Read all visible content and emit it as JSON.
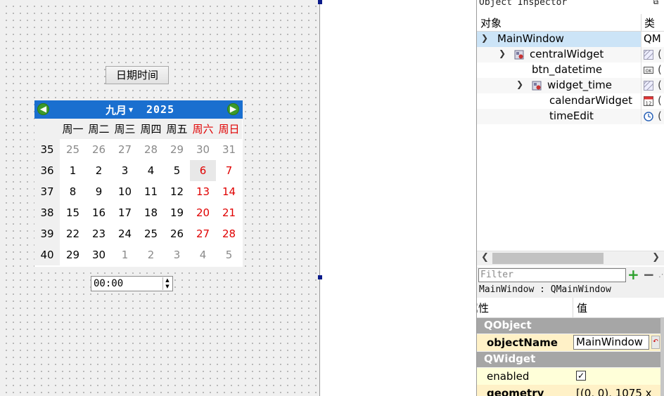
{
  "form": {
    "button_label": "日期时间",
    "calendar": {
      "month": "九月",
      "year": "2025",
      "weekday_headers": [
        "周一",
        "周二",
        "周三",
        "周四",
        "周五",
        "周六",
        "周日"
      ],
      "weeks": [
        {
          "num": "35",
          "days": [
            "25",
            "26",
            "27",
            "28",
            "29",
            "30",
            "31"
          ]
        },
        {
          "num": "36",
          "days": [
            "1",
            "2",
            "3",
            "4",
            "5",
            "6",
            "7"
          ]
        },
        {
          "num": "37",
          "days": [
            "8",
            "9",
            "10",
            "11",
            "12",
            "13",
            "14"
          ]
        },
        {
          "num": "38",
          "days": [
            "15",
            "16",
            "17",
            "18",
            "19",
            "20",
            "21"
          ]
        },
        {
          "num": "39",
          "days": [
            "22",
            "23",
            "24",
            "25",
            "26",
            "27",
            "28"
          ]
        },
        {
          "num": "40",
          "days": [
            "29",
            "30",
            "1",
            "2",
            "3",
            "4",
            "5"
          ]
        }
      ],
      "selected_day": "6"
    },
    "time_value": "00:00"
  },
  "inspector": {
    "title": "Object Inspector",
    "col_object": "对象",
    "col_class": "类",
    "tree": [
      {
        "name": "MainWindow",
        "class_text": "QM"
      },
      {
        "name": "centralWidget"
      },
      {
        "name": "btn_datetime"
      },
      {
        "name": "widget_time"
      },
      {
        "name": "calendarWidget"
      },
      {
        "name": "timeEdit"
      }
    ],
    "class_initial": "("
  },
  "property_editor": {
    "filter_placeholder": "Filter",
    "object_class": "MainWindow : QMainWindow",
    "col_property": "属性",
    "col_value": "值",
    "groups": [
      "QObject",
      "QWidget"
    ],
    "props": {
      "objectName": {
        "name": "objectName",
        "value": "MainWindow"
      },
      "enabled": {
        "name": "enabled"
      },
      "geometry": {
        "name": "geometry",
        "value": "[(0, 0), 1075 x"
      }
    }
  },
  "icons": {
    "nav_prev": "arrow-left-circle",
    "nav_next": "arrow-right-circle",
    "widget": "widget-layout-icon",
    "push_button": "push-button-icon",
    "calendar": "calendar-icon",
    "time": "clock-icon"
  },
  "colors": {
    "nav_bar": "#1a6fcf",
    "weekend_red": "#e00000",
    "tree_selection": "#cce4f7",
    "group_header": "#a6a6a6"
  }
}
